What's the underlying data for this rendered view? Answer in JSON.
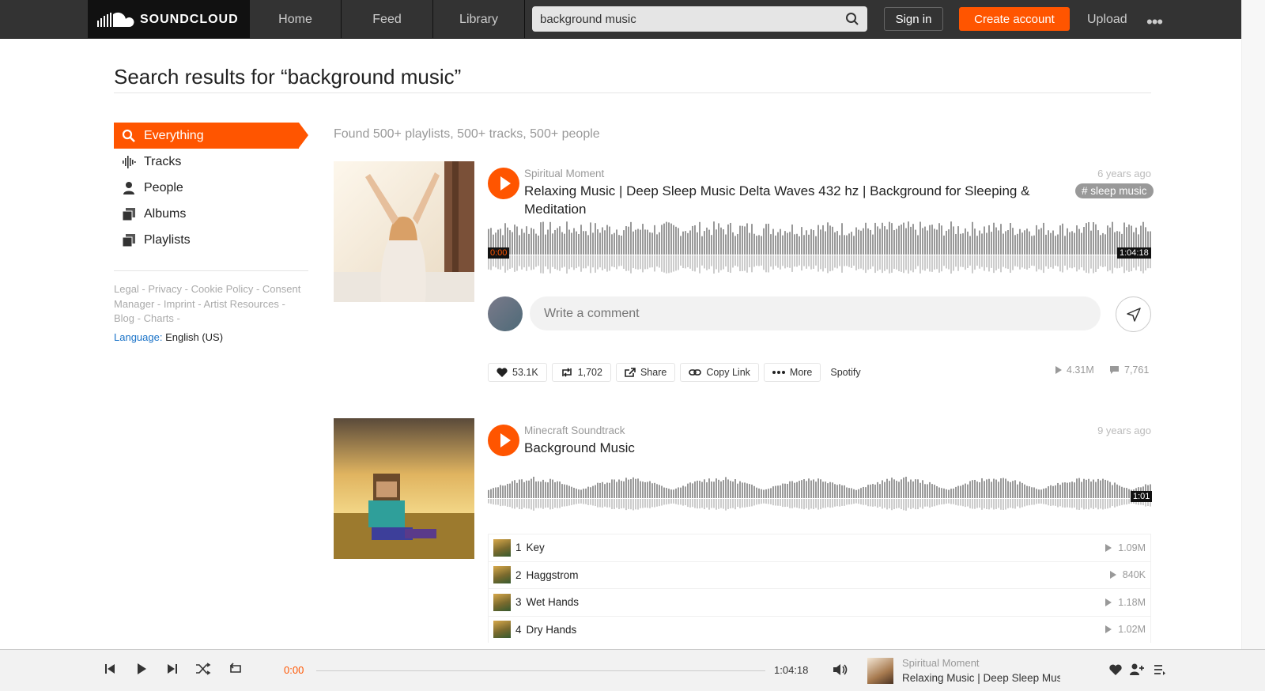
{
  "colors": {
    "accent": "#ff5500",
    "topbar": "#333333",
    "link_blue": "#1a73c8"
  },
  "topbar": {
    "logo_text": "SOUNDCLOUD",
    "nav": [
      "Home",
      "Feed",
      "Library"
    ],
    "search_value": "background music",
    "sign_in": "Sign in",
    "create_account": "Create account",
    "upload": "Upload",
    "more": "•••"
  },
  "page": {
    "title": "Search results for “background music”"
  },
  "sidebar": {
    "items": [
      {
        "label": "Everything",
        "icon": "search-icon"
      },
      {
        "label": "Tracks",
        "icon": "waveform-icon"
      },
      {
        "label": "People",
        "icon": "person-icon"
      },
      {
        "label": "Albums",
        "icon": "album-icon"
      },
      {
        "label": "Playlists",
        "icon": "playlist-icon"
      }
    ],
    "footer_links": [
      "Legal",
      "Privacy",
      "Cookie Policy",
      "Consent Manager",
      "Imprint",
      "Artist Resources",
      "Blog",
      "Charts"
    ],
    "language_label": "Language:",
    "language_value": "English (US)"
  },
  "results": {
    "found": "Found 500+ playlists, 500+ tracks, 500+ people",
    "track1": {
      "artist": "Spiritual Moment",
      "title": "Relaxing Music | Deep Sleep Music Delta Waves 432 hz | Background for Sleeping & Meditation",
      "posted": "6 years ago",
      "tag": "# sleep music",
      "time_start": "0:00",
      "time_end": "1:04:18",
      "comment_placeholder": "Write a comment",
      "likes": "53.1K",
      "reposts": "1,702",
      "share": "Share",
      "copy_link": "Copy Link",
      "more": "More",
      "spotify": "Spotify",
      "plays": "4.31M",
      "comments": "7,761"
    },
    "track2": {
      "artist": "Minecraft Soundtrack",
      "title": "Background Music",
      "posted": "9 years ago",
      "duration": "1:01",
      "tracks": [
        {
          "num": "1",
          "name": "Key",
          "plays": "1.09M"
        },
        {
          "num": "2",
          "name": "Haggstrom",
          "plays": "840K"
        },
        {
          "num": "3",
          "name": "Wet Hands",
          "plays": "1.18M"
        },
        {
          "num": "4",
          "name": "Dry Hands",
          "plays": "1.02M"
        }
      ]
    }
  },
  "player": {
    "current_time": "0:00",
    "duration": "1:04:18",
    "progress": 0,
    "artist": "Spiritual Moment",
    "title": "Relaxing Music | Deep Sleep Music D..."
  }
}
